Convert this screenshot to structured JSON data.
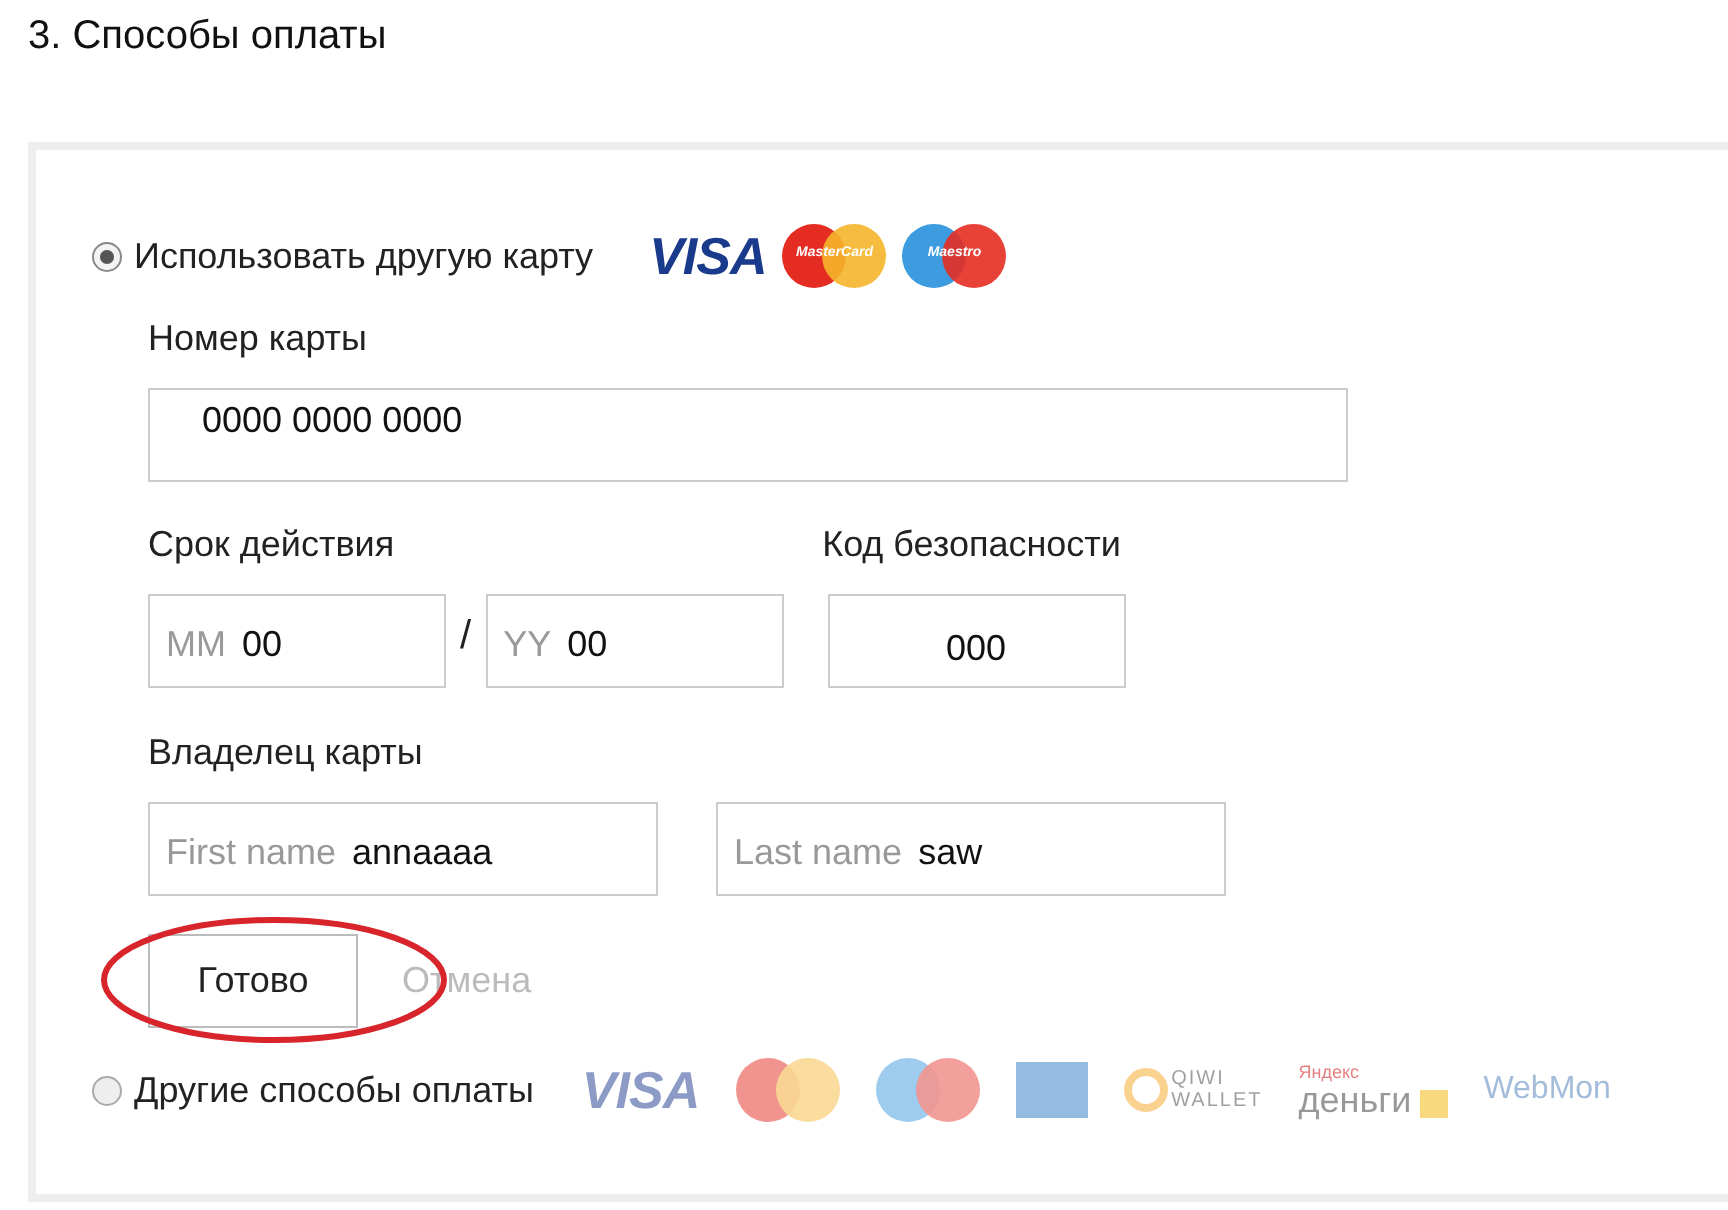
{
  "heading": "3. Способы оплаты",
  "payment_options": [
    {
      "label": "Использовать другую карту",
      "selected": true,
      "dimmed": false,
      "logos": [
        {
          "kind": "visa",
          "texts": [
            "VISA"
          ]
        },
        {
          "kind": "mastercard",
          "texts": [
            "MasterCard"
          ]
        },
        {
          "kind": "maestro",
          "texts": [
            "Maestro"
          ]
        }
      ]
    },
    {
      "label": "Другие способы оплаты",
      "selected": false,
      "dimmed": true,
      "logos": [
        {
          "kind": "visa",
          "texts": [
            "VISA"
          ]
        },
        {
          "kind": "mastercard"
        },
        {
          "kind": "maestro"
        },
        {
          "kind": "amex"
        },
        {
          "kind": "qiwi",
          "texts": [
            "QIWI",
            "WALLET"
          ]
        },
        {
          "kind": "yandex",
          "texts": [
            "Яндекс",
            "деньги"
          ]
        },
        {
          "kind": "webmoney",
          "texts": [
            "WebMon"
          ]
        }
      ]
    }
  ],
  "card_number": {
    "label": "Номер карты",
    "value": "0000 0000 0000"
  },
  "expiry": {
    "label": "Срок действия",
    "separator": "/",
    "month": {
      "placeholder": "MM",
      "value": "00"
    },
    "year": {
      "placeholder": "YY",
      "value": "00"
    }
  },
  "security_code": {
    "label": "Код безопасности",
    "value": "000"
  },
  "holder": {
    "label": "Владелец карты",
    "first_name": {
      "placeholder": "First name",
      "value": "annaaaa"
    },
    "last_name": {
      "placeholder": "Last name",
      "value": "saw"
    }
  },
  "buttons": {
    "done": {
      "label": "Готово",
      "circled": true
    },
    "cancel": {
      "label": "Отмена",
      "disabled": true
    }
  }
}
